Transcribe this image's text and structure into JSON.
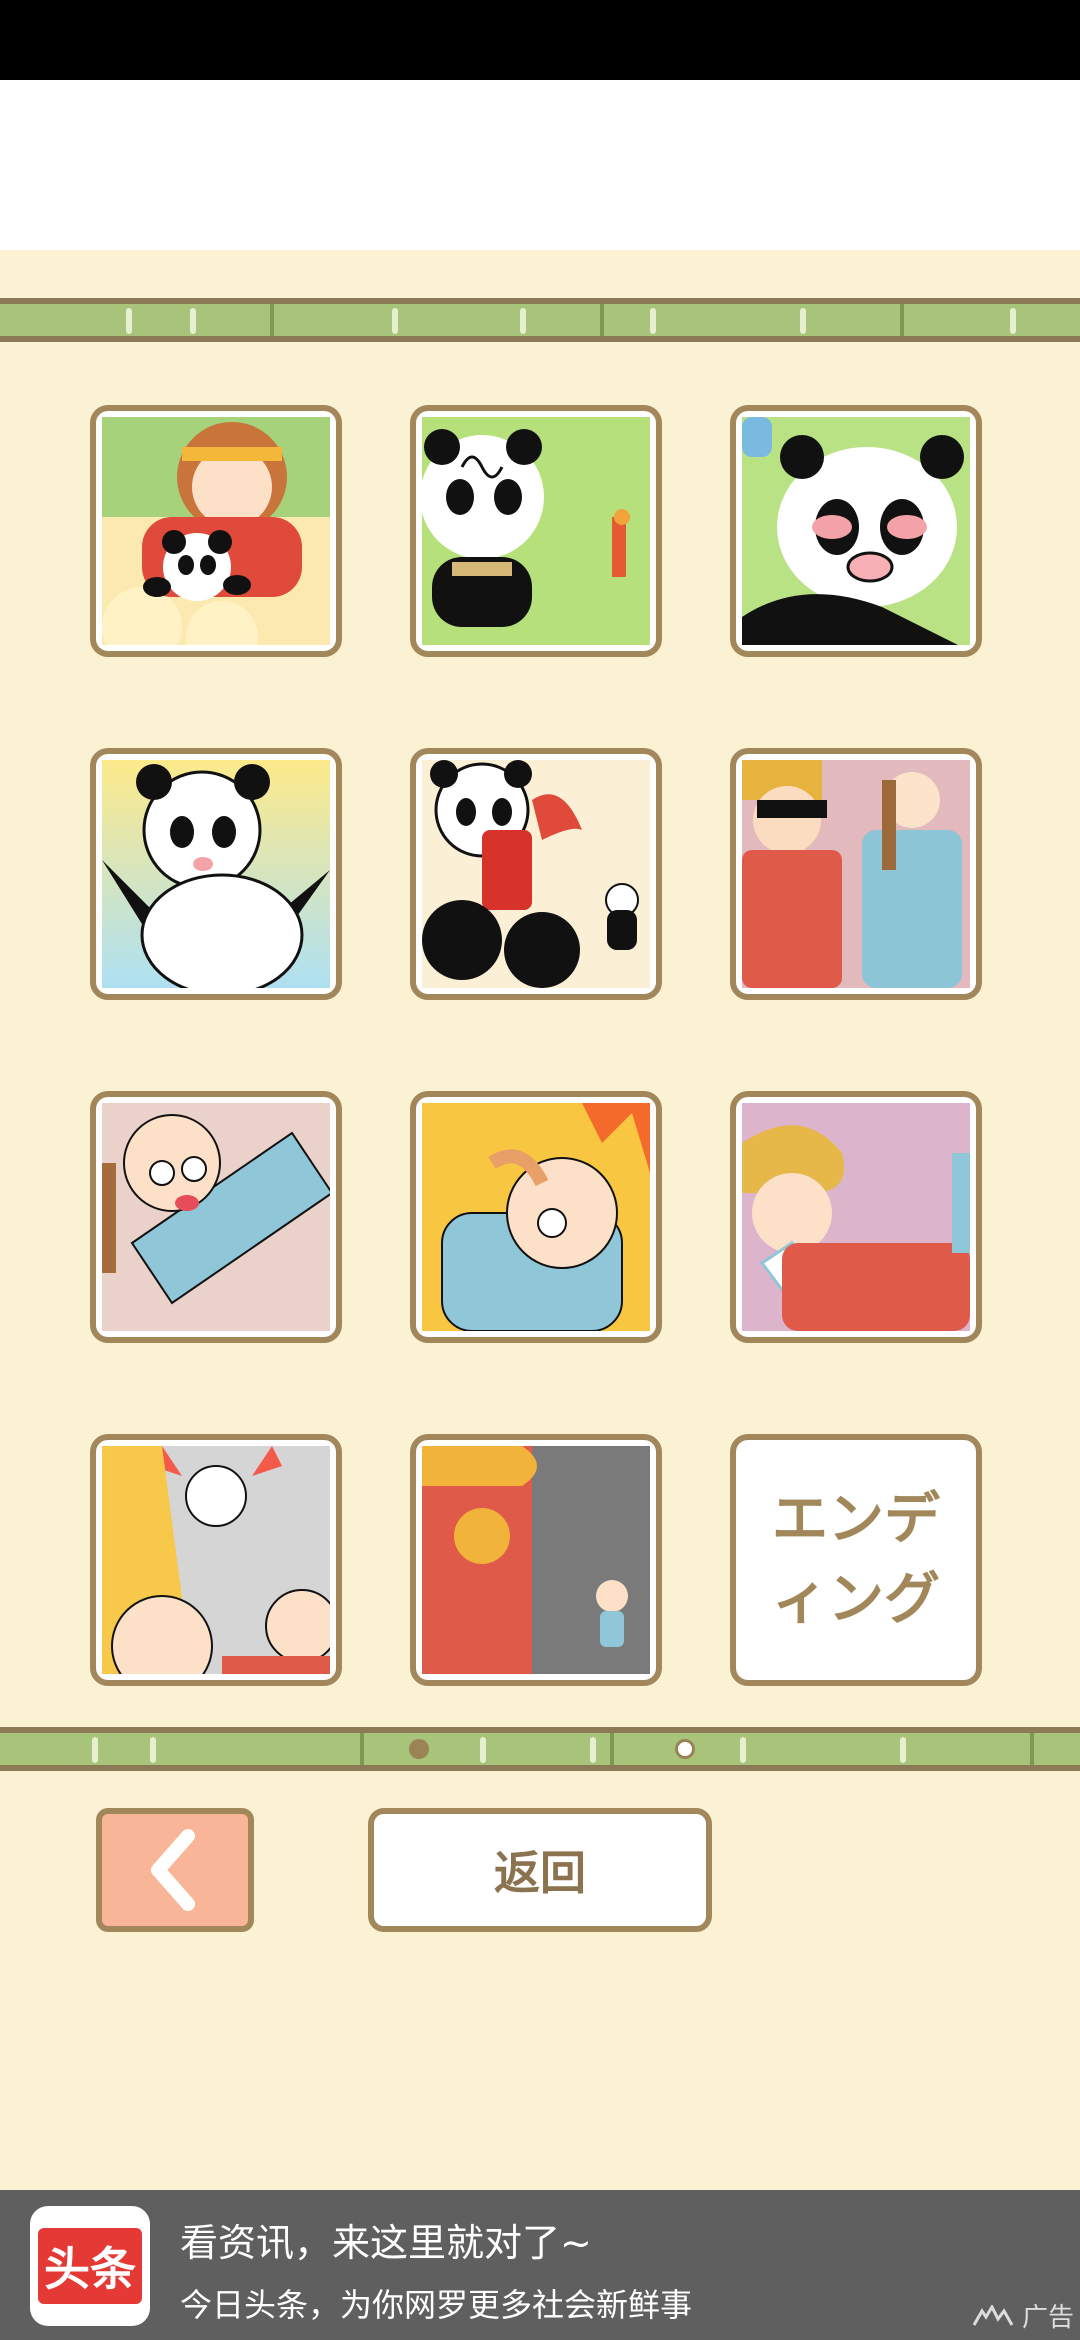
{
  "levels": [
    {
      "id": 1,
      "thumb": "monkey-king-panda"
    },
    {
      "id": 2,
      "thumb": "panda-dizzy"
    },
    {
      "id": 3,
      "thumb": "panda-crying"
    },
    {
      "id": 4,
      "thumb": "panda-happy"
    },
    {
      "id": 5,
      "thumb": "panda-barrel"
    },
    {
      "id": 6,
      "thumb": "workers-standing"
    },
    {
      "id": 7,
      "thumb": "old-man-knocked-out"
    },
    {
      "id": 8,
      "thumb": "old-man-fire"
    },
    {
      "id": 9,
      "thumb": "worker-punched"
    },
    {
      "id": 10,
      "thumb": "cat-shocked"
    },
    {
      "id": 11,
      "thumb": "dog-dark-room"
    }
  ],
  "ending_label": "エンデ\nィング",
  "pagination": {
    "current": 2,
    "total": 2
  },
  "buttons": {
    "back_icon": "chevron-left-icon",
    "return_label": "返回"
  },
  "ad": {
    "logo_text": "头条",
    "title": "看资讯，来这里就对了~",
    "subtitle": "今日头条，为你网罗更多社会新鲜事",
    "tag": "广告"
  },
  "colors": {
    "background": "#faf2d2",
    "frame": "#a2875a",
    "bamboo": "#a7c47a",
    "back_button": "#f8b597"
  }
}
